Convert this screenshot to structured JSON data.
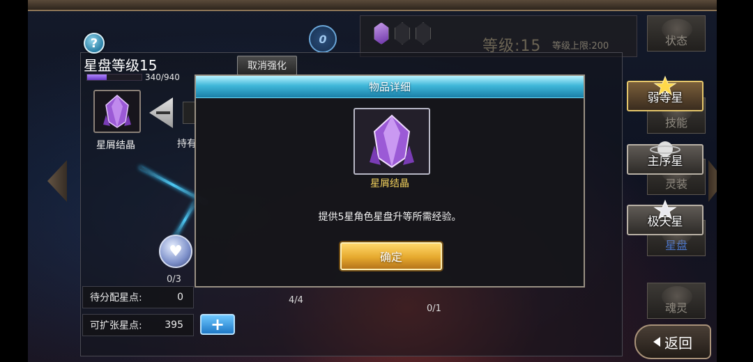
{
  "header": {
    "help_label": "?",
    "coin_value": "0",
    "level_text": "等级:15",
    "level_cap_text": "等级上限:200"
  },
  "star_disk": {
    "title": "星盘等级15",
    "exp_text": "340/940",
    "exp_progress": 0.362,
    "cancel_label": "取消强化",
    "item_label": "星屑结晶",
    "own_label": "持有",
    "nodes": [
      {
        "count": "0/3"
      },
      {
        "count": "4/4"
      },
      {
        "count": "0/1"
      }
    ],
    "unassigned_label": "待分配星点:",
    "unassigned_value": "0",
    "expandable_label": "可扩张星点:",
    "expandable_value": "395",
    "plus_label": "+"
  },
  "side_nav": {
    "items": [
      {
        "label": "状态"
      },
      {
        "label": "技能"
      },
      {
        "label": "灵装"
      },
      {
        "label": "星盘"
      },
      {
        "label": "魂灵"
      }
    ],
    "tiers": [
      {
        "label": "弱等星"
      },
      {
        "label": "主序星"
      },
      {
        "label": "极天星"
      }
    ],
    "back_label": "返回"
  },
  "modal": {
    "title": "物品详细",
    "item_name": "星屑结晶",
    "description": "提供5星角色星盘升等所需经验。",
    "confirm_label": "确定"
  },
  "colors": {
    "accent_cyan": "#3fb7d9",
    "gold": "#e6a92e",
    "item_name": "#f7d55e",
    "exp_bar": "#8a5ce0"
  }
}
